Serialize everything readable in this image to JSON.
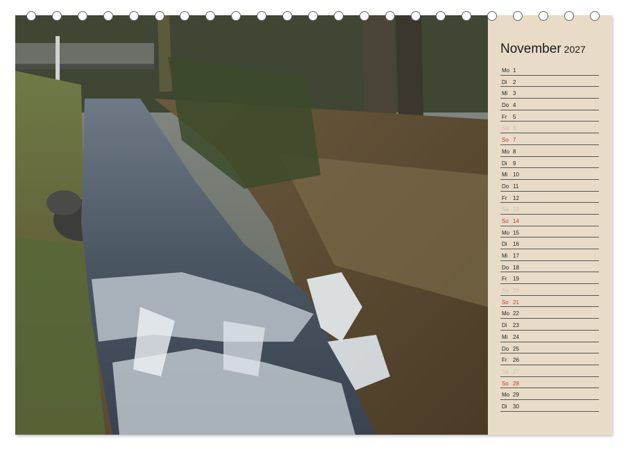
{
  "calendar": {
    "month": "November",
    "year": "2027",
    "days": [
      {
        "wd": "Mo",
        "d": "1",
        "type": "week"
      },
      {
        "wd": "Di",
        "d": "2",
        "type": "week"
      },
      {
        "wd": "Mi",
        "d": "3",
        "type": "week"
      },
      {
        "wd": "Do",
        "d": "4",
        "type": "week"
      },
      {
        "wd": "Fr",
        "d": "5",
        "type": "week"
      },
      {
        "wd": "Sa",
        "d": "6",
        "type": "sat"
      },
      {
        "wd": "So",
        "d": "7",
        "type": "sun"
      },
      {
        "wd": "Mo",
        "d": "8",
        "type": "week"
      },
      {
        "wd": "Di",
        "d": "9",
        "type": "week"
      },
      {
        "wd": "Mi",
        "d": "10",
        "type": "week"
      },
      {
        "wd": "Do",
        "d": "11",
        "type": "week"
      },
      {
        "wd": "Fr",
        "d": "12",
        "type": "week"
      },
      {
        "wd": "Sa",
        "d": "13",
        "type": "sat"
      },
      {
        "wd": "So",
        "d": "14",
        "type": "sun"
      },
      {
        "wd": "Mo",
        "d": "15",
        "type": "week"
      },
      {
        "wd": "Di",
        "d": "16",
        "type": "week"
      },
      {
        "wd": "Mi",
        "d": "17",
        "type": "week"
      },
      {
        "wd": "Do",
        "d": "18",
        "type": "week"
      },
      {
        "wd": "Fr",
        "d": "19",
        "type": "week"
      },
      {
        "wd": "Sa",
        "d": "20",
        "type": "sat"
      },
      {
        "wd": "So",
        "d": "21",
        "type": "sun"
      },
      {
        "wd": "Mo",
        "d": "22",
        "type": "week"
      },
      {
        "wd": "Di",
        "d": "23",
        "type": "week"
      },
      {
        "wd": "Mi",
        "d": "24",
        "type": "week"
      },
      {
        "wd": "Do",
        "d": "25",
        "type": "week"
      },
      {
        "wd": "Fr",
        "d": "26",
        "type": "week"
      },
      {
        "wd": "Sa",
        "d": "27",
        "type": "sat"
      },
      {
        "wd": "So",
        "d": "28",
        "type": "sun"
      },
      {
        "wd": "Mo",
        "d": "29",
        "type": "week"
      },
      {
        "wd": "Di",
        "d": "30",
        "type": "week"
      }
    ]
  },
  "colors": {
    "sidebar": "#e8dcc8",
    "sunday": "#c0392b",
    "saturday": "#c9bfb0",
    "text": "#1a1a1a"
  }
}
